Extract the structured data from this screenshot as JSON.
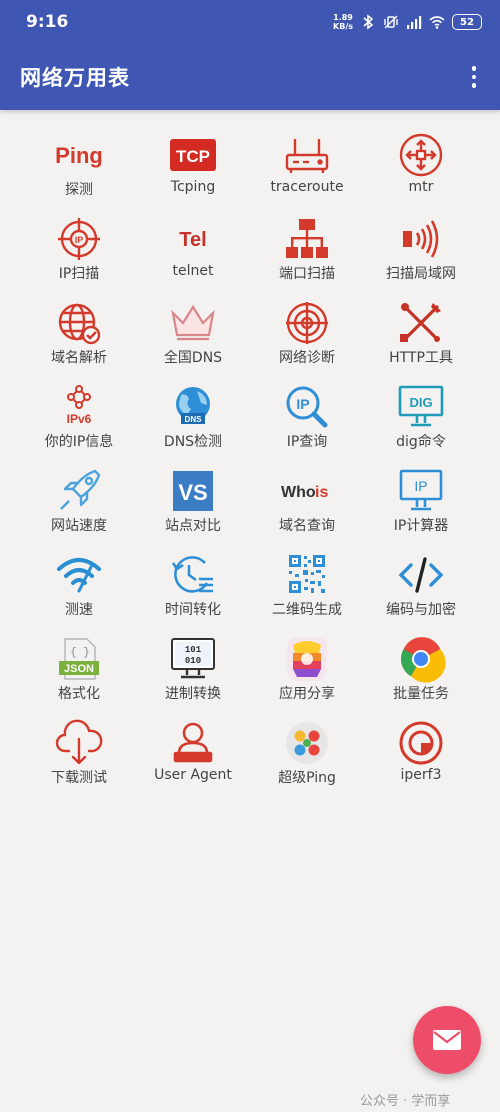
{
  "status_bar": {
    "time": "9:16",
    "net_speed_value": "1.89",
    "net_speed_unit": "KB/s",
    "battery": "52"
  },
  "app_bar": {
    "title": "网络万用表"
  },
  "tools": [
    {
      "label": "探测",
      "icon": "ping-icon",
      "icon_text": "Ping"
    },
    {
      "label": "Tcping",
      "icon": "tcp-icon",
      "icon_text": "TCP"
    },
    {
      "label": "traceroute",
      "icon": "router-icon"
    },
    {
      "label": "mtr",
      "icon": "compass-arrows-icon"
    },
    {
      "label": "IP扫描",
      "icon": "radar-ip-icon"
    },
    {
      "label": "telnet",
      "icon": "telnet-icon",
      "icon_text": "Tel"
    },
    {
      "label": "端口扫描",
      "icon": "network-tree-icon"
    },
    {
      "label": "扫描局域网",
      "icon": "signal-waves-icon"
    },
    {
      "label": "域名解析",
      "icon": "globe-check-icon"
    },
    {
      "label": "全国DNS",
      "icon": "crown-icon"
    },
    {
      "label": "网络诊断",
      "icon": "crosshair-icon"
    },
    {
      "label": "HTTP工具",
      "icon": "tools-icon"
    },
    {
      "label": "你的IP信息",
      "icon": "ipv6-icon",
      "icon_text": "IPv6"
    },
    {
      "label": "DNS检测",
      "icon": "dns-globe-icon",
      "icon_text": "DNS"
    },
    {
      "label": "IP查询",
      "icon": "ip-search-icon",
      "icon_text": "IP"
    },
    {
      "label": "dig命令",
      "icon": "dig-monitor-icon",
      "icon_text": "DIG"
    },
    {
      "label": "网站速度",
      "icon": "rocket-icon"
    },
    {
      "label": "站点对比",
      "icon": "vs-icon",
      "icon_text": "VS"
    },
    {
      "label": "域名查询",
      "icon": "whois-icon",
      "icon_text": "Who",
      "icon_text_2": "is"
    },
    {
      "label": "IP计算器",
      "icon": "ip-monitor-icon",
      "icon_text": "IP"
    },
    {
      "label": "测速",
      "icon": "wifi-speed-icon"
    },
    {
      "label": "时间转化",
      "icon": "time-history-icon"
    },
    {
      "label": "二维码生成",
      "icon": "qrcode-icon"
    },
    {
      "label": "编码与加密",
      "icon": "code-icon"
    },
    {
      "label": "格式化",
      "icon": "json-icon",
      "icon_text": "JSON"
    },
    {
      "label": "进制转换",
      "icon": "binary-icon",
      "icon_text": "101",
      "icon_text_2": "010"
    },
    {
      "label": "应用分享",
      "icon": "share-app-icon"
    },
    {
      "label": "批量任务",
      "icon": "chrome-icon"
    },
    {
      "label": "下载测试",
      "icon": "cloud-download-icon"
    },
    {
      "label": "User Agent",
      "icon": "user-agent-icon"
    },
    {
      "label": "超级Ping",
      "icon": "super-ping-icon"
    },
    {
      "label": "iperf3",
      "icon": "iperf-icon"
    }
  ],
  "watermark": "公众号 · 学而享",
  "colors": {
    "primary": "#3f57b2",
    "accent_red": "#d33a2c",
    "fab": "#ee4d6a",
    "background": "#f3f2f0"
  }
}
